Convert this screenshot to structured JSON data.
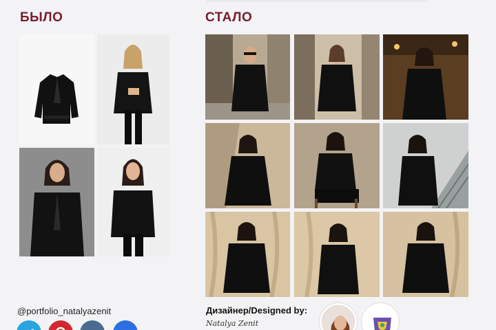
{
  "sections": {
    "before_title": "БЫЛО",
    "after_title": "СТАЛО"
  },
  "footer": {
    "handle": "@portfolio_natalyazenit",
    "designer_label": "Дизайнер/Designed by:",
    "signature": "Natalya Zenit"
  },
  "social_icons": [
    "telegram-icon",
    "pinterest-icon",
    "vk-icon",
    "vk-icon-blue"
  ],
  "colors": {
    "heading": "#7a1c2c",
    "background": "#f3f3f5",
    "telegram": "#2aa3df",
    "pinterest": "#d0282e",
    "vk_dark": "#4a6a8f",
    "vk_blue": "#2b6fe0"
  },
  "photos_before": [
    {
      "name": "black-leather-jacket-flatlay"
    },
    {
      "name": "blonde-model-leather-jacket"
    },
    {
      "name": "brunette-model-gray-backdrop"
    },
    {
      "name": "dark-hair-model-white-backdrop"
    }
  ],
  "photos_after": [
    {
      "name": "model-city-street-sunglasses"
    },
    {
      "name": "model-city-street-sunlight"
    },
    {
      "name": "model-cafe-interior"
    },
    {
      "name": "model-beige-wall-shadow"
    },
    {
      "name": "model-seated-chair"
    },
    {
      "name": "model-escalator-station"
    },
    {
      "name": "model-beige-drape-1"
    },
    {
      "name": "model-beige-drape-2"
    },
    {
      "name": "model-beige-drape-3"
    }
  ]
}
